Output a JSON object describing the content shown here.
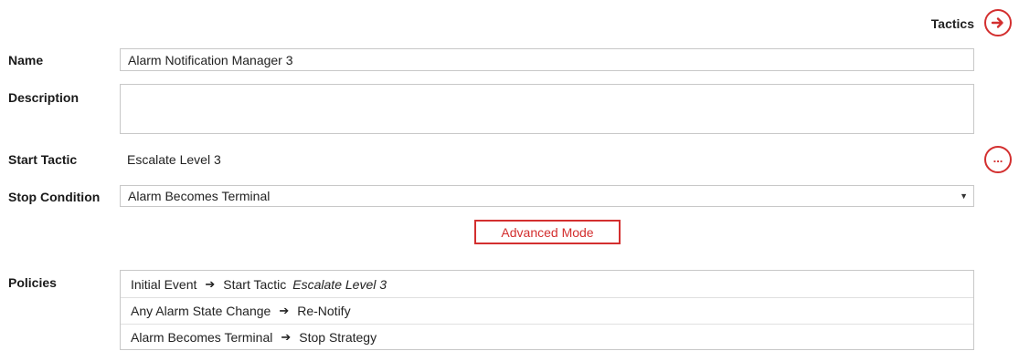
{
  "header": {
    "tactics_label": "Tactics",
    "tactics_icon": "arrow-right-circle-icon",
    "accent_color": "#d32f2f"
  },
  "form": {
    "name_label": "Name",
    "name_value": "Alarm Notification Manager 3",
    "description_label": "Description",
    "description_value": "",
    "start_tactic_label": "Start Tactic",
    "start_tactic_value": "Escalate Level 3",
    "ellipsis_label": "...",
    "stop_condition_label": "Stop Condition",
    "stop_condition_value": "Alarm Becomes Terminal",
    "advanced_mode_label": "Advanced Mode"
  },
  "policies": {
    "label": "Policies",
    "rows": [
      {
        "event": "Initial Event",
        "action": "Start Tactic",
        "param": "Escalate Level 3"
      },
      {
        "event": "Any Alarm State Change",
        "action": "Re-Notify",
        "param": ""
      },
      {
        "event": "Alarm Becomes Terminal",
        "action": "Stop Strategy",
        "param": ""
      }
    ]
  }
}
